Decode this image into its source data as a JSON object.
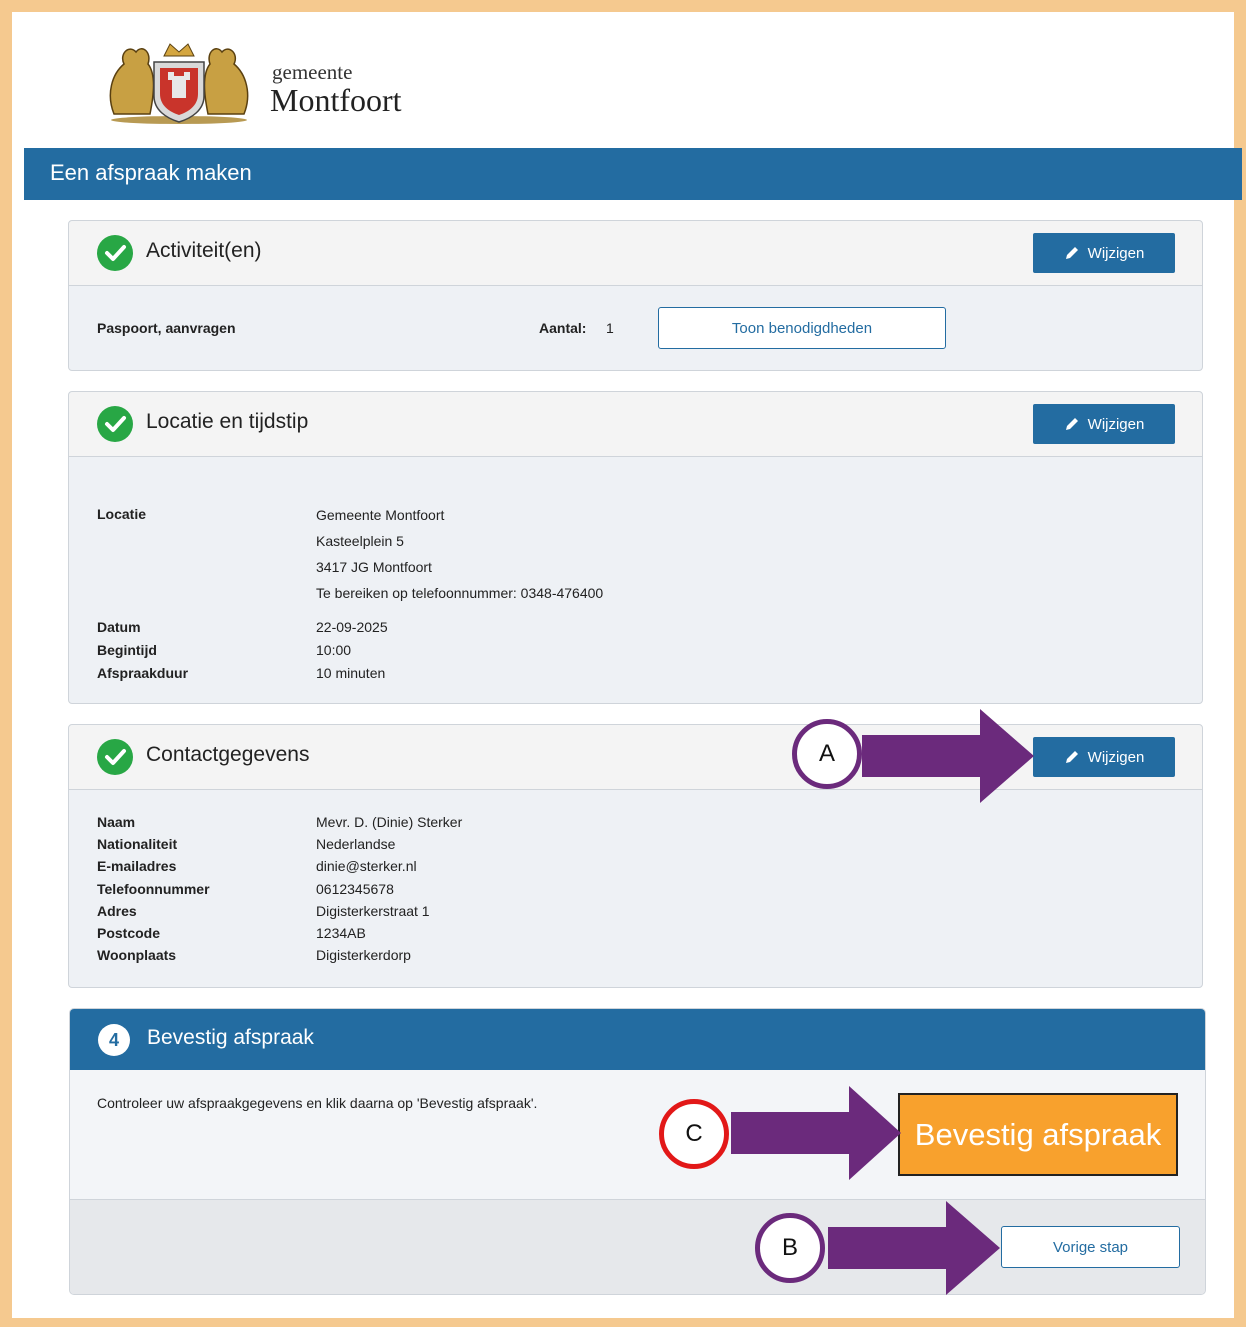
{
  "brand": {
    "line1": "gemeente",
    "line2": "Montfoort"
  },
  "header": {
    "title": "Een afspraak maken"
  },
  "sections": {
    "activities": {
      "title": "Activiteit(en)",
      "edit_label": "Wijzigen",
      "item_label": "Paspoort, aanvragen",
      "count_label": "Aantal:",
      "count_value": "1",
      "show_button": "Toon benodigdheden"
    },
    "location": {
      "title": "Locatie en tijdstip",
      "edit_label": "Wijzigen",
      "labels": {
        "location": "Locatie",
        "date": "Datum",
        "start": "Begintijd",
        "duration": "Afspraakduur"
      },
      "address": [
        "Gemeente Montfoort",
        "Kasteelplein 5",
        "3417 JG Montfoort",
        "Te bereiken op telefoonnummer: 0348-476400"
      ],
      "date": "22-09-2025",
      "start": "10:00",
      "duration": "10 minuten"
    },
    "contact": {
      "title": "Contactgegevens",
      "edit_label": "Wijzigen",
      "rows": [
        {
          "label": "Naam",
          "value": "Mevr. D. (Dinie) Sterker"
        },
        {
          "label": "Nationaliteit",
          "value": "Nederlandse"
        },
        {
          "label": "E-mailadres",
          "value": "dinie@sterker.nl"
        },
        {
          "label": "Telefoonnummer",
          "value": "0612345678"
        },
        {
          "label": "Adres",
          "value": "Digisterkerstraat 1"
        },
        {
          "label": "Postcode",
          "value": "1234AB"
        },
        {
          "label": "Woonplaats",
          "value": "Digisterkerdorp"
        }
      ]
    },
    "confirm": {
      "step": "4",
      "title": "Bevestig afspraak",
      "instruction": "Controleer uw afspraakgegevens en klik daarna op 'Bevestig afspraak'.",
      "confirm_button": "Bevestig afspraak",
      "back_button": "Vorige stap"
    }
  },
  "annotations": {
    "a": "A",
    "b": "B",
    "c": "C"
  },
  "colors": {
    "primary": "#236ca1",
    "success": "#28a745",
    "confirm": "#f8a12d",
    "arrow": "#6b2a7c",
    "frame": "#f5c98f"
  },
  "icons": [
    "coat-of-arms-logo",
    "check-circle-icon",
    "pencil-icon",
    "arrow-right-icon"
  ]
}
